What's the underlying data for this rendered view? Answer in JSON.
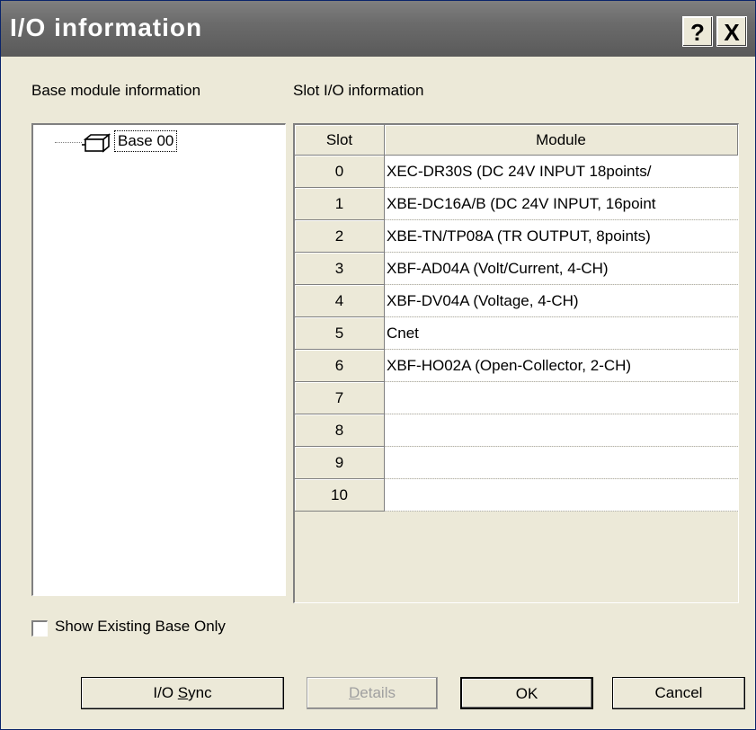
{
  "window": {
    "title": "I/O information",
    "help_label": "?",
    "close_label": "X"
  },
  "base_panel": {
    "label": "Base module information",
    "tree_item": "Base 00"
  },
  "slot_panel": {
    "label": "Slot I/O information",
    "columns": [
      "Slot",
      "Module"
    ],
    "rows": [
      {
        "slot": "0",
        "module": "XEC-DR30S (DC 24V INPUT 18points/"
      },
      {
        "slot": "1",
        "module": "XBE-DC16A/B (DC 24V INPUT, 16point"
      },
      {
        "slot": "2",
        "module": "XBE-TN/TP08A (TR OUTPUT, 8points)"
      },
      {
        "slot": "3",
        "module": "XBF-AD04A (Volt/Current, 4-CH)"
      },
      {
        "slot": "4",
        "module": "XBF-DV04A (Voltage, 4-CH)"
      },
      {
        "slot": "5",
        "module": "Cnet"
      },
      {
        "slot": "6",
        "module": "XBF-HO02A (Open-Collector, 2-CH)"
      },
      {
        "slot": "7",
        "module": ""
      },
      {
        "slot": "8",
        "module": ""
      },
      {
        "slot": "9",
        "module": ""
      },
      {
        "slot": "10",
        "module": ""
      }
    ]
  },
  "options": {
    "show_existing_label": "Show Existing Base Only",
    "show_existing_checked": false
  },
  "buttons": {
    "io_sync_prefix": "I/O ",
    "io_sync_mnemonic": "S",
    "io_sync_suffix": "ync",
    "details_mnemonic": "D",
    "details_suffix": "etails",
    "ok": "OK",
    "cancel": "Cancel"
  }
}
